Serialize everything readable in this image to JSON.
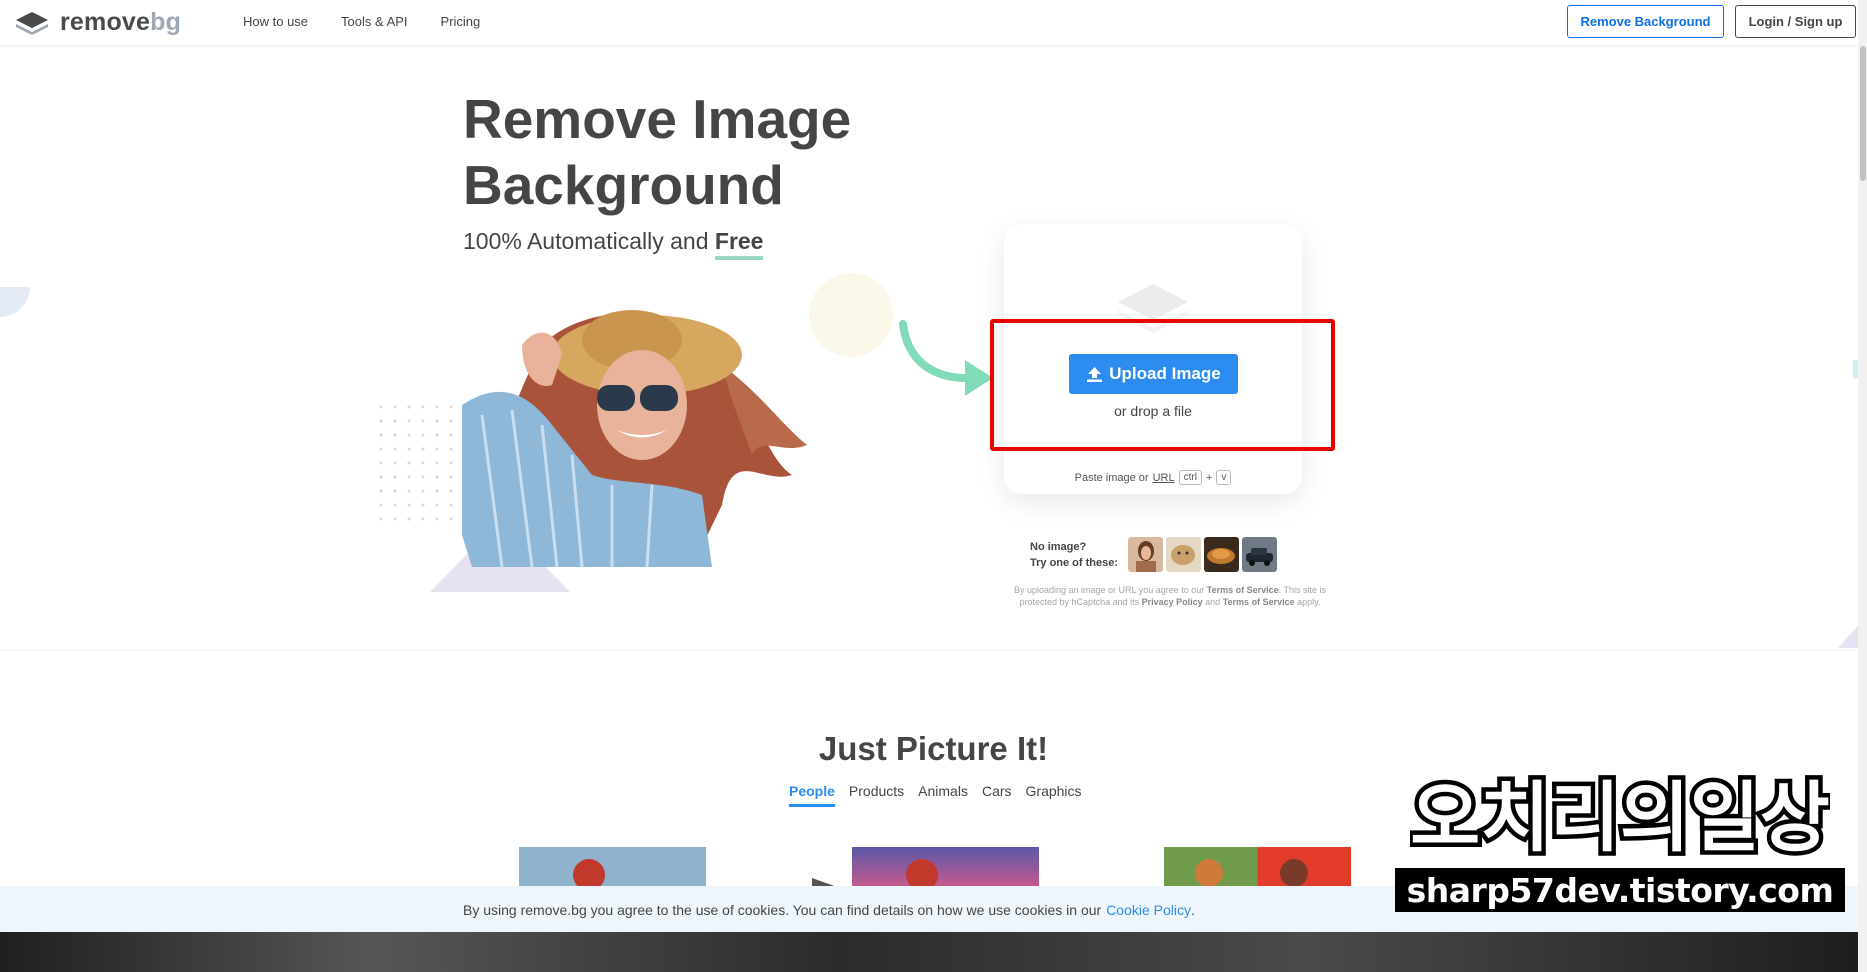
{
  "header": {
    "logo_main": "remove",
    "logo_accent": "bg",
    "nav": [
      "How to use",
      "Tools & API",
      "Pricing"
    ],
    "remove_bg_button": "Remove Background",
    "login_button": "Login / Sign up"
  },
  "hero": {
    "title_line1": "Remove Image",
    "title_line2": "Background",
    "subtitle_prefix": "100% Automatically and",
    "subtitle_emphasis": "Free"
  },
  "upload": {
    "button_label": "Upload Image",
    "drop_text": "or drop a file",
    "paste_prefix": "Paste image or",
    "paste_url": "URL",
    "key_ctrl": "ctrl",
    "key_plus": "+",
    "key_v": "v"
  },
  "samples": {
    "line1": "No image?",
    "line2": "Try one of these:"
  },
  "legal": {
    "part1": "By uploading an image or URL you agree to our",
    "tos": "Terms of Service",
    "part2": ". This site is protected by hCaptcha and its",
    "privacy": "Privacy Policy",
    "part3": "and",
    "tos2": "Terms of Service",
    "part4": "apply."
  },
  "examples": {
    "title": "Just Picture It!",
    "tabs": [
      "People",
      "Products",
      "Animals",
      "Cars",
      "Graphics"
    ],
    "active_tab": "People"
  },
  "cookie": {
    "text": "By using remove.bg you agree to the use of cookies. You can find details on how we use cookies in our",
    "link": "Cookie Policy",
    "suffix": "."
  },
  "watermark": {
    "korean": "오치리의일상",
    "url": "sharp57dev.tistory.com"
  },
  "colors": {
    "accent_blue": "#2d8cf0",
    "highlight_red": "#e60000",
    "underline_green": "#9ad8c5"
  }
}
